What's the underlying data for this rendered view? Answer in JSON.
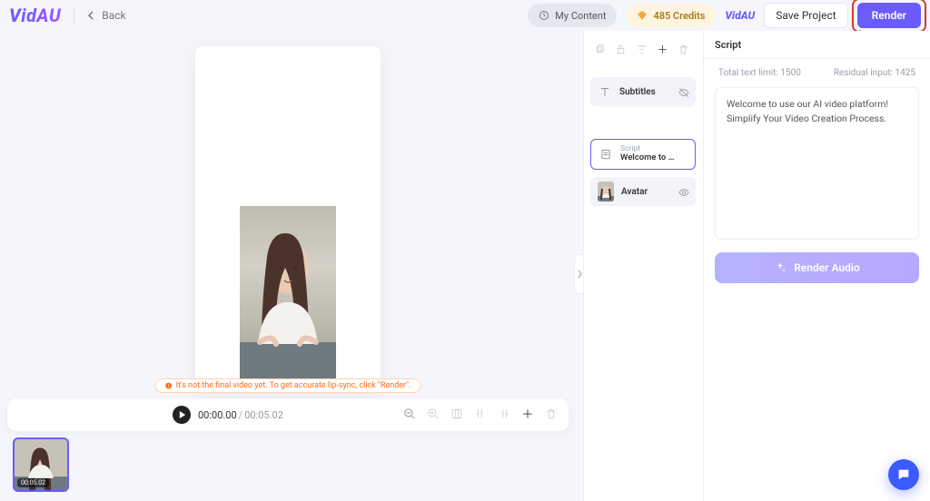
{
  "header": {
    "logo": "VidAU",
    "back": "Back",
    "my_content": "My Content",
    "credits_value": "485 Credits",
    "mini_logo": "VidAU",
    "save": "Save Project",
    "render": "Render"
  },
  "canvas": {
    "tip": "It's not the final video yet. To get accurate lip-sync, click \"Render\"."
  },
  "timeline": {
    "current": "00:00.00",
    "duration": "00:05.02",
    "scene_time": "00:05.02"
  },
  "layers": {
    "subtitles": "Subtitles",
    "script_label": "Script",
    "script_preview": "Welcome to u...",
    "avatar": "Avatar"
  },
  "script_panel": {
    "title": "Script",
    "total_label": "Total text limit: 1500",
    "residual_label": "Residual input: 1425",
    "text": "Welcome to use our AI video platform! Simplify Your Video Creation Process.",
    "render_audio": "Render Audio"
  }
}
